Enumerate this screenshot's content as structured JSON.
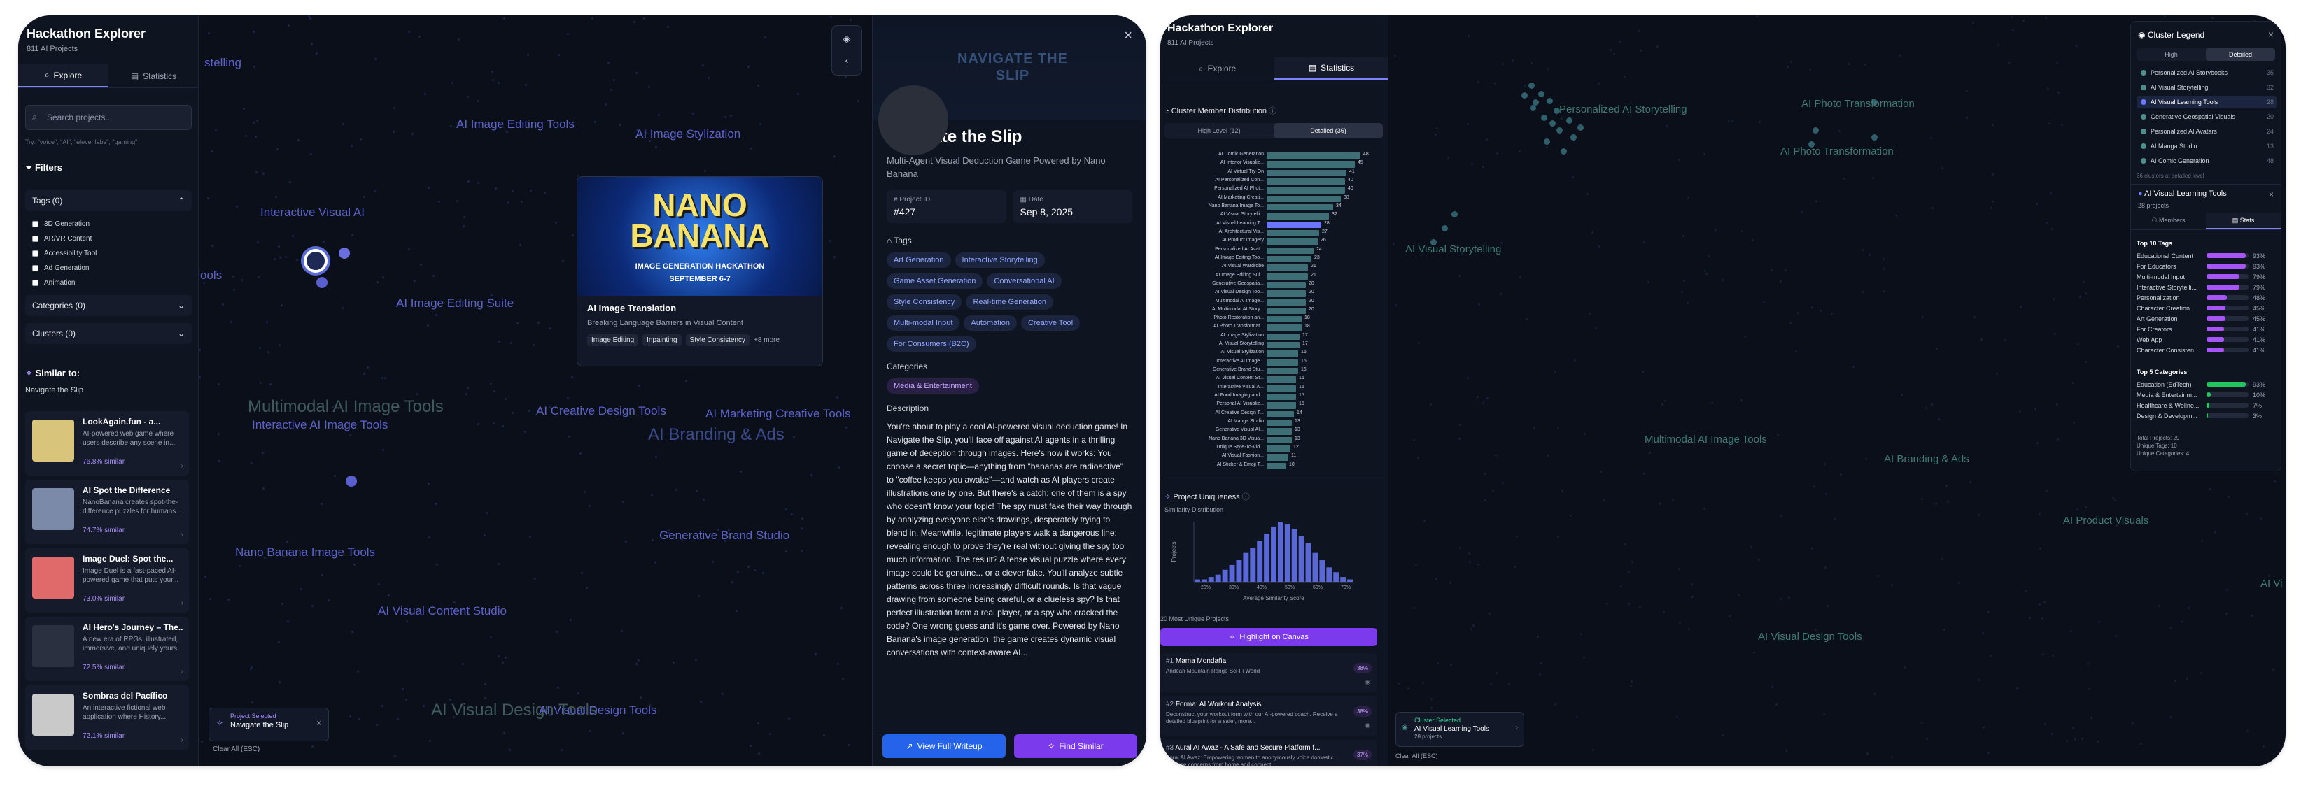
{
  "app": {
    "title": "Hackathon Explorer",
    "count": "811 AI Projects"
  },
  "tabs": {
    "explore": "Explore",
    "statistics": "Statistics"
  },
  "search": {
    "placeholder": "Search projects...",
    "hint": "Try: \"voice\", \"AI\", \"elevenlabs\", \"gaming\""
  },
  "filters": {
    "title": "Filters",
    "tags": "Tags (0)",
    "tag_options": [
      "3D Generation",
      "AR/VR Content",
      "Accessibility Tool",
      "Ad Generation",
      "Animation"
    ],
    "categories": "Categories (0)",
    "clusters": "Clusters (0)"
  },
  "similar": {
    "title": "Similar to:",
    "name": "Navigate the Slip",
    "items": [
      {
        "title": "LookAgain.fun - a...",
        "desc": "AI-powered web game where users describe any scene in...",
        "sim": "76.8% similar",
        "color": "#d8c47a"
      },
      {
        "title": "AI Spot the Difference",
        "desc": "NanoBanana creates spot-the-difference puzzles for humans...",
        "sim": "74.7% similar",
        "color": "#7a8aa8"
      },
      {
        "title": "Image Duel: Spot the...",
        "desc": "Image Duel is a fast-paced AI-powered game that puts your...",
        "sim": "73.0% similar",
        "color": "#e06a6a"
      },
      {
        "title": "AI Hero's Journey – The...",
        "desc": "A new era of RPGs: illustrated, immersive, and uniquely yours.",
        "sim": "72.5% similar",
        "color": "#2a3040"
      },
      {
        "title": "Sombras del Pacífico",
        "desc": "An interactive fictional web application where History...",
        "sim": "72.1% similar",
        "color": "#c9c9c9"
      }
    ]
  },
  "canvas_labels": [
    "AI Image Editing Tools",
    "AI Image Stylization",
    "Interactive Visual AI",
    "AI Image Editing Suite",
    "Multimodal AI Image Tools",
    "Interactive AI Image Tools",
    "AI Creative Design Tools",
    "AI Marketing Creative Tools",
    "AI Branding & Ads",
    "Nano Banana Image Tools",
    "Generative Brand Studio",
    "AI Visual Content Studio",
    "AI Visual Design Tools",
    "AI Visual Design Tools",
    "stelling",
    "ools"
  ],
  "selection": {
    "label": "Project Selected",
    "name": "Navigate the Slip",
    "clear": "Clear All (ESC)"
  },
  "hover": {
    "banner_line1": "NANO",
    "banner_line2": "BANANA",
    "banner_sub": "IMAGE GENERATION HACKATHON",
    "banner_date": "SEPTEMBER 6-7",
    "title": "AI Image Translation",
    "desc": "Breaking Language Barriers in Visual Content",
    "tags": [
      "Image Editing",
      "Inpainting",
      "Style Consistency"
    ],
    "more": "+8 more"
  },
  "detail": {
    "hero": "NAVIGATE THE SLIP",
    "title": "Navigate the Slip",
    "subtitle": "Multi-Agent Visual Deduction Game Powered by Nano Banana",
    "id_label": "Project ID",
    "id": "#427",
    "date_label": "Date",
    "date": "Sep 8, 2025",
    "tags_label": "Tags",
    "tags": [
      "Art Generation",
      "Interactive Storytelling",
      "Game Asset Generation",
      "Conversational AI",
      "Style Consistency",
      "Real-time Generation",
      "Multi-modal Input",
      "Automation",
      "Creative Tool",
      "For Consumers (B2C)"
    ],
    "categories_label": "Categories",
    "category": "Media & Entertainment",
    "desc_label": "Description",
    "description": "You're about to play a cool AI-powered visual deduction game! In Navigate the Slip, you'll face off against AI agents in a thrilling game of deception through images. Here's how it works: You choose a secret topic—anything from \"bananas are radioactive\" to \"coffee keeps you awake\"—and watch as AI players create illustrations one by one. But there's a catch: one of them is a spy who doesn't know your topic! The spy must fake their way through by analyzing everyone else's drawings, desperately trying to blend in. Meanwhile, legitimate players walk a dangerous line: revealing enough to prove they're real without giving the spy too much information. The result? A tense visual puzzle where every image could be genuine... or a clever fake. You'll analyze subtle patterns across three increasingly difficult rounds. Is that vague drawing from someone being careful, or a clueless spy? Is that perfect illustration from a real player, or a spy who cracked the code? One wrong guess and it's game over. Powered by Nano Banana's image generation, the game creates dynamic visual conversations with context-aware AI...",
    "btn_writeup": "View Full Writeup",
    "btn_similar": "Find Similar"
  },
  "stats": {
    "dist_title": "Cluster Member Distribution",
    "toggle_high": "High Level (12)",
    "toggle_detailed": "Detailed (36)",
    "clusters": [
      {
        "n": "AI Comic Generation",
        "v": 48
      },
      {
        "n": "AI Interior Visualiz...",
        "v": 45
      },
      {
        "n": "AI Virtual Try-On",
        "v": 41
      },
      {
        "n": "AI Personalized Con...",
        "v": 40
      },
      {
        "n": "Personalized AI Phot...",
        "v": 40
      },
      {
        "n": "AI Marketing Creati...",
        "v": 38
      },
      {
        "n": "Nano Banana Image To...",
        "v": 34
      },
      {
        "n": "AI Visual Storytelli...",
        "v": 32
      },
      {
        "n": "AI Visual Learning T...",
        "v": 28
      },
      {
        "n": "AI Architectural Vis...",
        "v": 27
      },
      {
        "n": "AI Product Imagery",
        "v": 26
      },
      {
        "n": "Personalized AI Avat...",
        "v": 24
      },
      {
        "n": "AI Image Editing Too...",
        "v": 23
      },
      {
        "n": "AI Visual Wardrobe",
        "v": 21
      },
      {
        "n": "AI Image Editing Sui...",
        "v": 21
      },
      {
        "n": "Generative Geospatia...",
        "v": 20
      },
      {
        "n": "AI Visual Design Too...",
        "v": 20
      },
      {
        "n": "Multimodal AI Image...",
        "v": 20
      },
      {
        "n": "AI Multimodal AI Story...",
        "v": 20
      },
      {
        "n": "Photo Restoration an...",
        "v": 18
      },
      {
        "n": "AI Photo Transformat...",
        "v": 18
      },
      {
        "n": "AI Image Stylization",
        "v": 17
      },
      {
        "n": "AI Visual Storytelling",
        "v": 17
      },
      {
        "n": "AI Visual Stylization",
        "v": 16
      },
      {
        "n": "Interactive AI Image...",
        "v": 16
      },
      {
        "n": "Generative Brand Stu...",
        "v": 16
      },
      {
        "n": "AI Visual Content St...",
        "v": 15
      },
      {
        "n": "Interactive Visual A...",
        "v": 15
      },
      {
        "n": "AI Food Imaging and...",
        "v": 15
      },
      {
        "n": "Personal AI Visualiz...",
        "v": 15
      },
      {
        "n": "AI Creative Design T...",
        "v": 14
      },
      {
        "n": "AI Manga Studio",
        "v": 13
      },
      {
        "n": "Generative Visual AI...",
        "v": 13
      },
      {
        "n": "Nano Banana 3D Visua...",
        "v": 13
      },
      {
        "n": "Unique Style-To-Vid...",
        "v": 12
      },
      {
        "n": "AI Visual Fashion...",
        "v": 11
      },
      {
        "n": "AI Sticker & Emoji T...",
        "v": 10
      }
    ],
    "dist_max": 48,
    "uniq_title": "Project Uniqueness",
    "sim_dist": "Similarity Distribution",
    "xlabel": "Average Similarity Score",
    "ylabel": "Projects",
    "hist": [
      1,
      1,
      2,
      3,
      5,
      7,
      9,
      12,
      14,
      17,
      20,
      23,
      25,
      24,
      22,
      19,
      16,
      12,
      9,
      6,
      4,
      2,
      1
    ],
    "xticks": [
      "20%",
      "30%",
      "40%",
      "50%",
      "60%",
      "70%"
    ],
    "most_unique": "20 Most Unique Projects",
    "highlight": "Highlight on Canvas",
    "unique": [
      {
        "rank": "#1",
        "name": "Mama Mondaña",
        "desc": "Andean Mountain Range Sci-Fi World",
        "pct": "38%"
      },
      {
        "rank": "#2",
        "name": "Forma: AI Workout Analysis",
        "desc": "Deconstruct your workout form with our AI-powered coach. Receive a detailed blueprint for a safer, more...",
        "pct": "38%"
      },
      {
        "rank": "#3",
        "name": "Aural AI Awaz - A Safe and Secure Platform f...",
        "desc": "Aural AI Awaz: Empowering women to anonymously voice domestic violence concerns from home and connect...",
        "pct": "37%"
      }
    ]
  },
  "right_canvas_labels": [
    "Personalized AI Storytelling",
    "AI Photo Transformation",
    "AI Photo Transformation",
    "AI Visual Storytelling",
    "Multimodal AI Image Tools",
    "AI Branding & Ads",
    "AI Product Visuals",
    "AI Visual Design Tools",
    "AI Vi"
  ],
  "legend": {
    "title": "Cluster Legend",
    "high": "High",
    "detailed": "Detailed",
    "items": [
      {
        "n": "Personalized AI Storybooks",
        "v": "35",
        "c": "#4f8f8a"
      },
      {
        "n": "AI Visual Storytelling",
        "v": "32",
        "c": "#4f8f8a"
      },
      {
        "n": "AI Visual Learning Tools",
        "v": "28",
        "c": "#6b77ff"
      },
      {
        "n": "Generative Geospatial Visuals",
        "v": "20",
        "c": "#4f8f8a"
      },
      {
        "n": "Personalized AI Avatars",
        "v": "24",
        "c": "#4f8f8a"
      },
      {
        "n": "AI Manga Studio",
        "v": "13",
        "c": "#4f8f8a"
      },
      {
        "n": "AI Comic Generation",
        "v": "48",
        "c": "#4f8f8a"
      }
    ],
    "note": "36 clusters at detailed level",
    "sel_name": "AI Visual Learning Tools",
    "sel_count": "28 projects",
    "members_tab": "Members",
    "stats_tab": "Stats",
    "top_tags_title": "Top 10 Tags",
    "top_tags": [
      {
        "n": "Educational Content",
        "p": "93%",
        "v": 93
      },
      {
        "n": "For Educators",
        "p": "93%",
        "v": 93
      },
      {
        "n": "Multi-modal Input",
        "p": "79%",
        "v": 79
      },
      {
        "n": "Interactive Storytelli...",
        "p": "79%",
        "v": 79
      },
      {
        "n": "Personalization",
        "p": "48%",
        "v": 48
      },
      {
        "n": "Character Creation",
        "p": "45%",
        "v": 45
      },
      {
        "n": "Art Generation",
        "p": "45%",
        "v": 45
      },
      {
        "n": "For Creators",
        "p": "41%",
        "v": 41
      },
      {
        "n": "Web App",
        "p": "41%",
        "v": 41
      },
      {
        "n": "Character Consisten...",
        "p": "41%",
        "v": 41
      }
    ],
    "top_cats_title": "Top 5 Categories",
    "top_cats": [
      {
        "n": "Education (EdTech)",
        "p": "93%",
        "v": 93
      },
      {
        "n": "Media & Entertainm...",
        "p": "10%",
        "v": 10
      },
      {
        "n": "Healthcare & Wellne...",
        "p": "7%",
        "v": 7
      },
      {
        "n": "Design & Developm...",
        "p": "3%",
        "v": 3
      }
    ],
    "totals": [
      "Total Projects: 29",
      "Unique Tags: 10",
      "Unique Categories: 4"
    ]
  },
  "right_selection": {
    "label": "Cluster Selected",
    "name": "AI Visual Learning Tools",
    "count": "28 projects",
    "clear": "Clear All (ESC)"
  }
}
